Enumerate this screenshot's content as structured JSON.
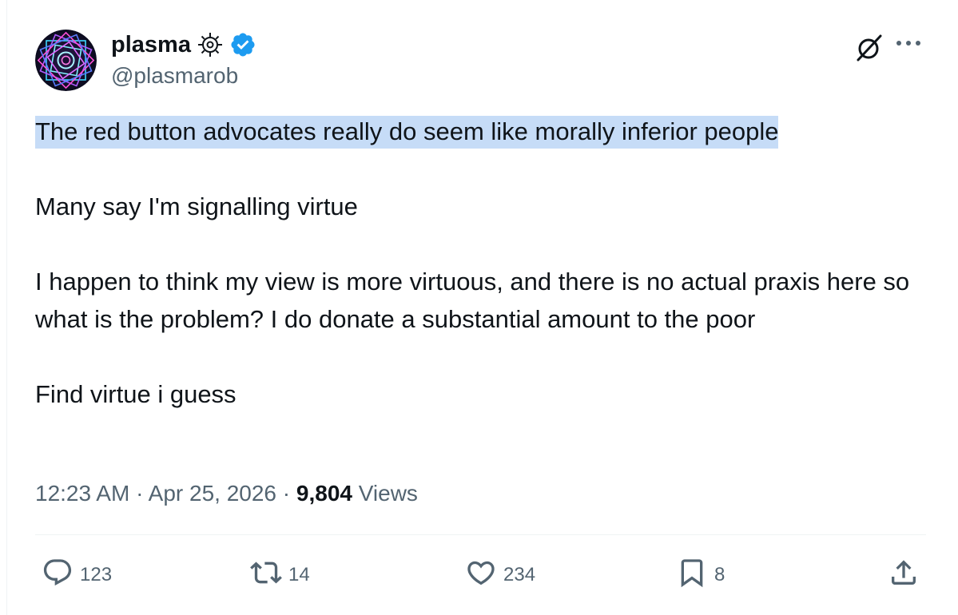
{
  "author": {
    "display_name": "plasma",
    "handle": "@plasmarob",
    "avatar_icon": "geometric-mandala-avatar",
    "affiliate_icon": "sun-badge-icon",
    "verified_icon": "verified-badge-icon",
    "verified_color": "#1d9bf0"
  },
  "header_actions": {
    "grok_icon": "grok-icon",
    "more_icon": "more-dots-icon"
  },
  "tweet": {
    "highlighted_line": "The red button advocates really do seem like morally inferior people",
    "line_2": "Many say I'm signalling virtue",
    "line_3": "I happen to think my view is more virtuous, and there is no actual praxis here so what is the problem? I do donate a substantial amount to the poor",
    "line_4": "Find virtue i guess",
    "highlight_color": "#c6dcf7"
  },
  "meta": {
    "time": "12:23 AM",
    "separator": "·",
    "date": "Apr 25, 2026",
    "views_count": "9,804",
    "views_label": "Views"
  },
  "actions": {
    "reply_count": "123",
    "retweet_count": "14",
    "like_count": "234",
    "bookmark_count": "8",
    "reply_icon": "reply-icon",
    "retweet_icon": "retweet-icon",
    "like_icon": "heart-icon",
    "bookmark_icon": "bookmark-icon",
    "share_icon": "share-icon"
  },
  "colors": {
    "text_primary": "#0f1419",
    "text_secondary": "#536471",
    "divider": "#eff3f4"
  }
}
